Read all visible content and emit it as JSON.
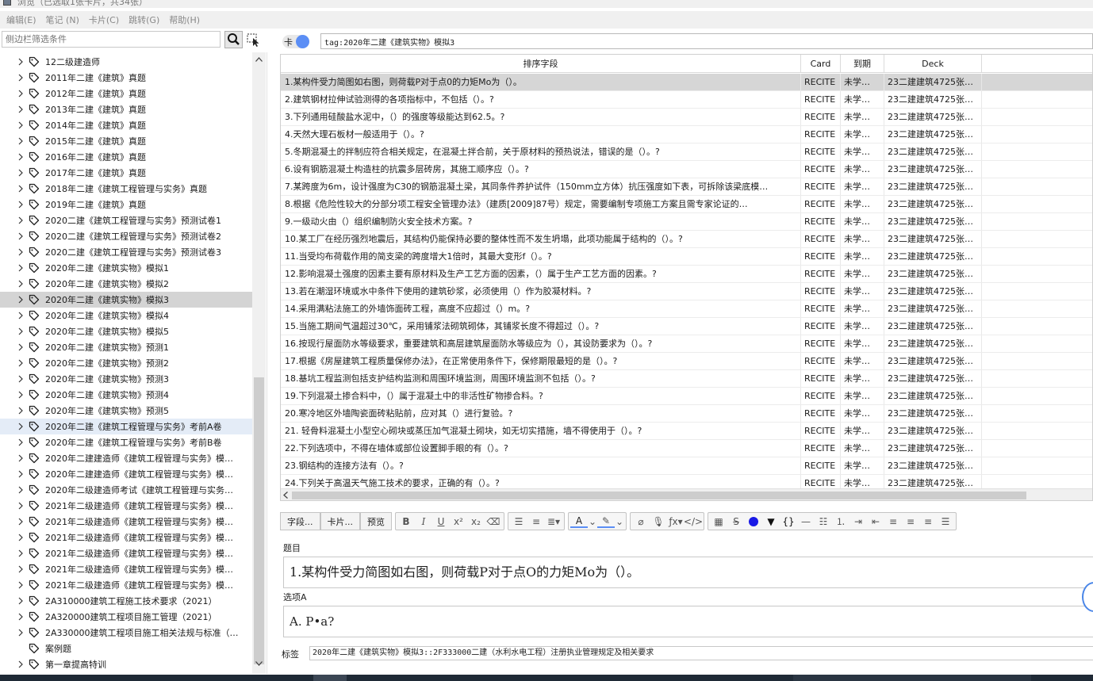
{
  "window": {
    "title": "浏览（已选取1张卡片，共34张）"
  },
  "menu": [
    "编辑(E)",
    "笔记 (N)",
    "卡片(C)",
    "跳转(G)",
    "帮助(H)"
  ],
  "sidebar": {
    "filter_placeholder": "侧边栏筛选条件",
    "items": [
      "12二级建造师",
      "2011年二建《建筑》真题",
      "2012年二建《建筑》真题",
      "2013年二建《建筑》真题",
      "2014年二建《建筑》真题",
      "2015年二建《建筑》真题",
      "2016年二建《建筑》真题",
      "2017年二建《建筑》真题",
      "2018年二建《建筑工程管理与实务》真题",
      "2019年二建《建筑》真题",
      "2020二建《建筑工程管理与实务》预测试卷1",
      "2020二建《建筑工程管理与实务》预测试卷2",
      "2020二建《建筑工程管理与实务》预测试卷3",
      "2020年二建《建筑实物》模拟1",
      "2020年二建《建筑实物》模拟2",
      "2020年二建《建筑实物》模拟3",
      "2020年二建《建筑实物》模拟4",
      "2020年二建《建筑实物》模拟5",
      "2020年二建《建筑实物》预测1",
      "2020年二建《建筑实物》预测2",
      "2020年二建《建筑实物》预测3",
      "2020年二建《建筑实物》预测4",
      "2020年二建《建筑实物》预测5",
      "2020年二建《建筑工程管理与实务》考前A卷",
      "2020年二建《建筑工程管理与实务》考前B卷",
      "2020年二建建造师《建筑工程管理与实务》模…",
      "2020年二建建造师《建筑工程管理与实务》模…",
      "2020年二级建造师考试《建筑工程管理与实务…",
      "2021年二级建造师《建筑工程管理与实务》模…",
      "2021年二级建造师《建筑工程管理与实务》模…",
      "2021年二级建造师《建筑工程管理与实务》模…",
      "2021年二级建造师《建筑工程管理与实务》模…",
      "2021年二级建造师《建筑工程管理与实务》模…",
      "2021年二级建造师《建筑工程管理与实务》模…",
      "2A310000建筑工程施工技术要求（2021）",
      "2A320000建筑工程项目施工管理（2021）",
      "2A330000建筑工程项目施工相关法规与标准（…",
      "案例题",
      "第一章提高特训"
    ],
    "selected_index": 15,
    "hover_index": 23,
    "no_expander_index": 37
  },
  "toolbar": {
    "mode_label": "卡",
    "query": "tag:2020年二建《建筑实物》模拟3"
  },
  "table": {
    "headers": [
      "排序字段",
      "Card",
      "到期",
      "Deck"
    ],
    "card_value": "RECITE",
    "due_value": "未学…",
    "deck_value": "23二建建筑4725张…",
    "selected_row": 0,
    "rows": [
      "1.某构件受力简图如右图，则荷载P对于点0的力矩Mo为（）。",
      "2.建筑钢材拉伸试验测得的各项指标中，不包括（）。?",
      "3.下列通用硅酸盐水泥中，（）的强度等级能达到62.5。?",
      "4.天然大理石板材一般适用于（）。?",
      "5.冬期混凝土的拌制应符合相关规定，在混凝土拌合前，关于原材料的预热说法，错误的是（）。?",
      "6.设有钢筋混凝土构造柱的抗震多层砖房，其施工顺序应（）。?",
      "7.某跨度为6m，设计强度为C30的钢筋混凝土梁，其同条件养护试件（150mm立方体）抗压强度如下表，可拆除该梁底模…",
      "8.根据《危险性较大的分部分项工程安全管理办法》（建质[2009]87号）规定，需要编制专项施工方案且需专家论证的…",
      "9.一级动火由（）组织编制防火安全技术方案。?",
      "10.某工厂在经历强烈地震后，其结构仍能保持必要的整体性而不发生坍塌，此项功能属于结构的（）。?",
      "11.当受均布荷载作用的简支梁的跨度增大1倍时，其最大变形f（）。?",
      "12.影响混凝土强度的因素主要有原材料及生产工艺方面的因素，（）属于生产工艺方面的因素。?",
      "13.若在潮湿环境或水中条件下使用的建筑砂浆，必须使用（）作为胶凝材料。?",
      "14.采用满粘法施工的外墙饰面砖工程，高度不应超过（）m。?",
      "15.当施工期间气温超过30℃，采用铺浆法砌筑砌体，其铺浆长度不得超过（）。?",
      "16.按现行屋面防水等级要求，重要建筑和高层建筑屋面防水等级应为（），其设防要求为（）。?",
      "17.根据《房屋建筑工程质量保修办法》，在正常使用条件下，保修期限最短的是（）。?",
      "18.基坑工程监测包括支护结构监测和周围环境监测，周围环境监测不包括（）。?",
      "19.下列混凝土掺合料中，（）属于混凝土中的非活性矿物掺合料。?",
      "20.寒冷地区外墙陶瓷面砖粘贴前，应对其（）进行复验。?",
      "21. 轻骨料混凝土小型空心砌块或蒸压加气混凝土砌块，如无切实措施，墙不得使用于（）。?",
      "22.下列选项中，不得在墙体或部位设置脚手眼的有（）。?",
      "23.钢结构的连接方法有（）。?",
      "24.下列关于高温天气施工技术的要求，正确的有（）。?"
    ]
  },
  "editor": {
    "fields_btn": "字段...",
    "cards_btn": "卡片...",
    "preview_btn": "预览",
    "fields": [
      {
        "name": "题目",
        "value": "1.某构件受力简图如右图，则荷载P对于点O的力矩Mo为（）。"
      },
      {
        "name": "选项A",
        "value": "A. P•a?"
      }
    ],
    "tags_label": "标签",
    "tags_value": "2020年二建《建筑实物》模拟3::2F333000二建（水利水电工程）注册执业管理规定及相关要求"
  },
  "colors": {
    "accent": "#4a86e8",
    "selection": "#d6d6d6"
  }
}
